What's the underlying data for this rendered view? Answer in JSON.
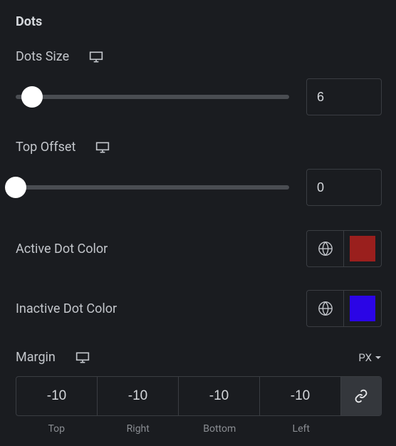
{
  "section": {
    "title": "Dots"
  },
  "dotsSize": {
    "label": "Dots Size",
    "value": "6",
    "sliderPercent": 6
  },
  "topOffset": {
    "label": "Top Offset",
    "value": "0",
    "sliderPercent": 0
  },
  "activeDotColor": {
    "label": "Active Dot Color",
    "color": "#9a1f1d"
  },
  "inactiveDotColor": {
    "label": "Inactive Dot Color",
    "color": "#2b05e6"
  },
  "margin": {
    "label": "Margin",
    "unit": "PX",
    "top": "-10",
    "right": "-10",
    "bottom": "-10",
    "left": "-10",
    "labels": {
      "top": "Top",
      "right": "Right",
      "bottom": "Bottom",
      "left": "Left"
    }
  }
}
